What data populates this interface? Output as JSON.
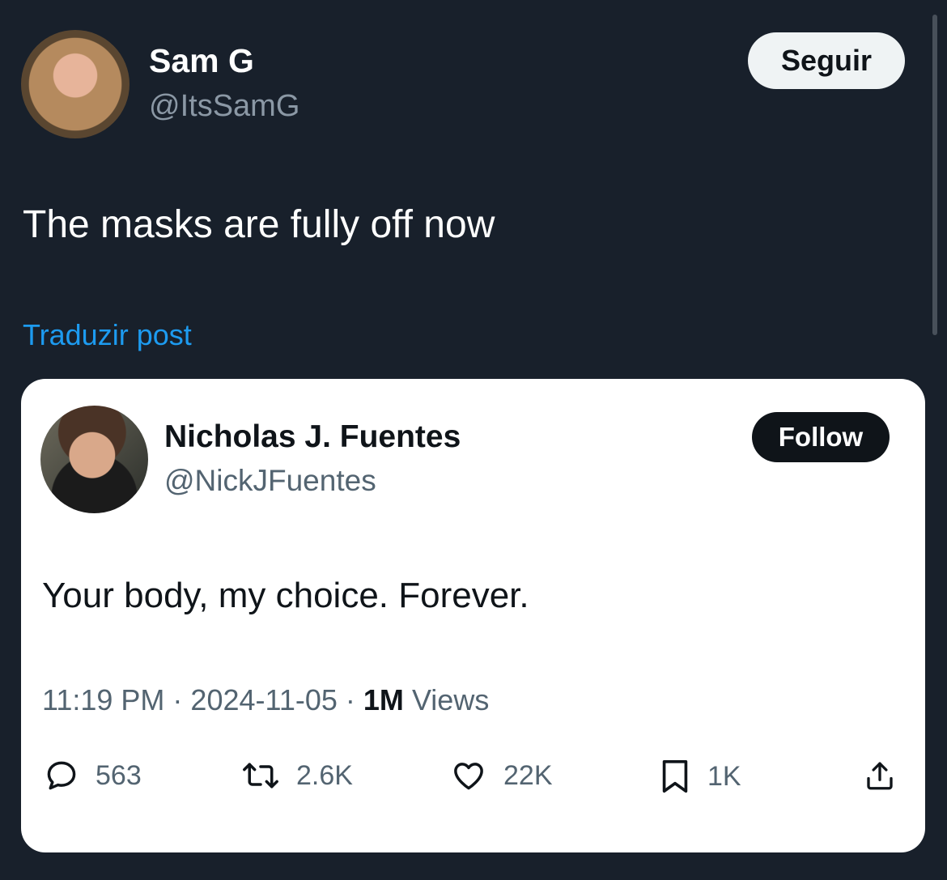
{
  "outer": {
    "author_name": "Sam G",
    "author_handle": "@ItsSamG",
    "follow_label": "Seguir",
    "text": "The masks are fully off now",
    "translate_label": "Traduzir post"
  },
  "quoted": {
    "author_name": "Nicholas J. Fuentes",
    "author_handle": "@NickJFuentes",
    "follow_label": "Follow",
    "text": "Your body, my choice. Forever.",
    "time": "11:19 PM",
    "date": "2024-11-05",
    "sep": " · ",
    "views_count": "1M",
    "views_label": "Views",
    "actions": {
      "replies": "563",
      "reposts": "2.6K",
      "likes": "22K",
      "bookmarks": "1K"
    }
  },
  "icons": {
    "reply": "reply-icon",
    "repost": "repost-icon",
    "like": "heart-icon",
    "bookmark": "bookmark-icon",
    "share": "share-icon"
  },
  "colors": {
    "background": "#18202b",
    "link": "#1d9bf0",
    "muted_dark": "#8b98a5",
    "muted_light": "#536471"
  }
}
